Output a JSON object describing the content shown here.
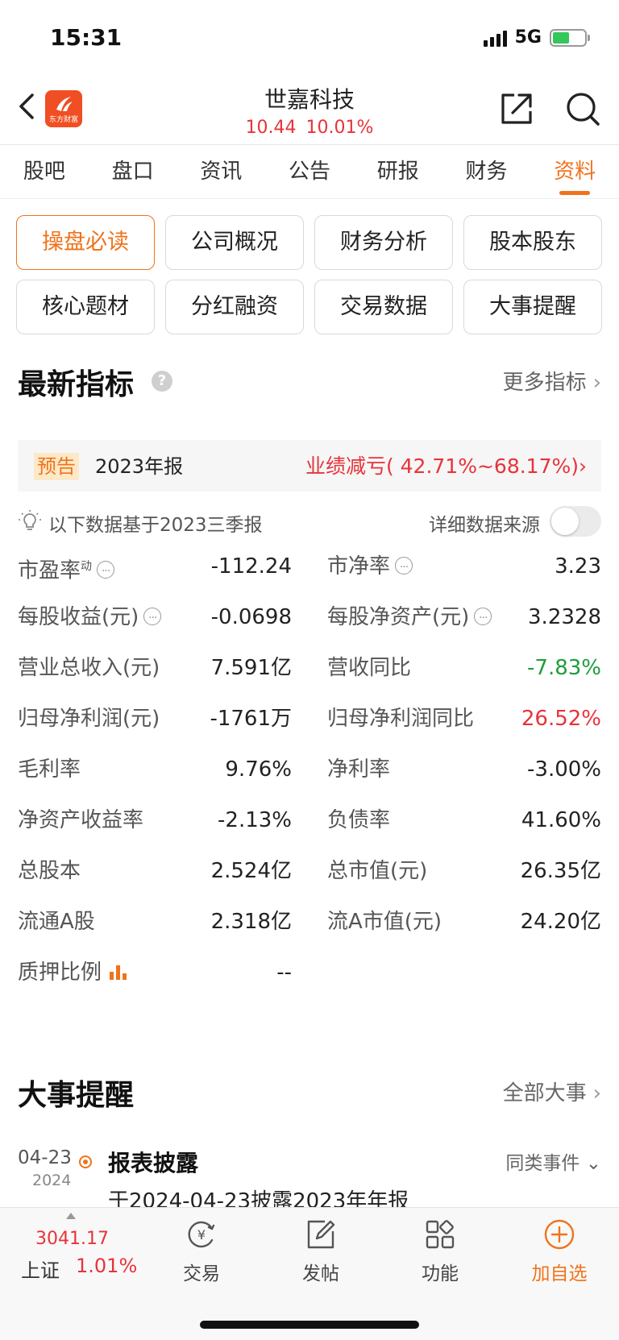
{
  "status_bar": {
    "time": "15:31",
    "network": "5G"
  },
  "header": {
    "title": "世嘉科技",
    "price": "10.44",
    "change_pct": "10.01%",
    "logo_text": "东方财富"
  },
  "tabs": [
    {
      "label": "股吧"
    },
    {
      "label": "盘口"
    },
    {
      "label": "资讯"
    },
    {
      "label": "公告"
    },
    {
      "label": "研报"
    },
    {
      "label": "财务"
    },
    {
      "label": "资料",
      "active": true
    }
  ],
  "subnav": [
    {
      "label": "操盘必读",
      "active": true
    },
    {
      "label": "公司概况"
    },
    {
      "label": "财务分析"
    },
    {
      "label": "股本股东"
    },
    {
      "label": "核心题材"
    },
    {
      "label": "分红融资"
    },
    {
      "label": "交易数据"
    },
    {
      "label": "大事提醒"
    }
  ],
  "indicators": {
    "title": "最新指标",
    "more": "更多指标",
    "forecast": {
      "tag": "预告",
      "report": "2023年报",
      "result": "业绩减亏( 42.71%~68.17%)"
    },
    "basis": "以下数据基于2023三季报",
    "source_label": "详细数据来源",
    "rows": [
      {
        "left": {
          "label": "市盈率",
          "sup": "动",
          "value": "-112.24"
        },
        "right": {
          "label": "市净率",
          "value": "3.23"
        }
      },
      {
        "left": {
          "label": "每股收益(元)",
          "value": "-0.0698"
        },
        "right": {
          "label": "每股净资产(元)",
          "value": "3.2328"
        }
      },
      {
        "left": {
          "label": "营业总收入(元)",
          "value": "7.591亿"
        },
        "right": {
          "label": "营收同比",
          "value": "-7.83%"
        }
      },
      {
        "left": {
          "label": "归母净利润(元)",
          "value": "-1761万"
        },
        "right": {
          "label": "归母净利润同比",
          "value": "26.52%"
        }
      },
      {
        "left": {
          "label": "毛利率",
          "value": "9.76%"
        },
        "right": {
          "label": "净利率",
          "value": "-3.00%"
        }
      },
      {
        "left": {
          "label": "净资产收益率",
          "value": "-2.13%"
        },
        "right": {
          "label": "负债率",
          "value": "41.60%"
        }
      },
      {
        "left": {
          "label": "总股本",
          "value": "2.524亿"
        },
        "right": {
          "label": "总市值(元)",
          "value": "26.35亿"
        }
      },
      {
        "left": {
          "label": "流通A股",
          "value": "2.318亿"
        },
        "right": {
          "label": "流A市值(元)",
          "value": "24.20亿"
        }
      },
      {
        "left": {
          "label": "质押比例",
          "value": "--"
        }
      }
    ]
  },
  "events": {
    "title": "大事提醒",
    "more": "全部大事",
    "items": [
      {
        "date": "04-23",
        "year": "2024",
        "title": "报表披露",
        "similar": "同类事件",
        "desc": "于2024-04-23披露2023年年报"
      }
    ]
  },
  "bottom_bar": {
    "index_value": "3041.17",
    "index_name": "上证",
    "index_change": "1.01%",
    "actions": [
      {
        "label": "交易",
        "icon": "trade-icon"
      },
      {
        "label": "发帖",
        "icon": "post-icon"
      },
      {
        "label": "功能",
        "icon": "apps-icon"
      },
      {
        "label": "加自选",
        "icon": "add-watchlist-icon"
      }
    ]
  },
  "colors": {
    "accent": "#f0731b",
    "up": "#e8333a",
    "down": "#1f9d3a"
  }
}
